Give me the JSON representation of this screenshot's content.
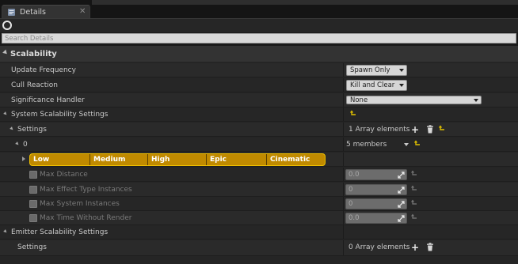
{
  "tab": {
    "title": "Details",
    "close": "✕",
    "icon": "details-icon"
  },
  "toolbar": {
    "icon": "lock-icon"
  },
  "search": {
    "placeholder": "Search Details",
    "value": ""
  },
  "category": {
    "label": "Scalability"
  },
  "properties": {
    "update_frequency": {
      "label": "Update Frequency",
      "value": "Spawn Only"
    },
    "cull_reaction": {
      "label": "Cull Reaction",
      "value": "Kill and Clear"
    },
    "significance_handler": {
      "label": "Significance Handler",
      "value": "None"
    }
  },
  "system_scalability": {
    "label": "System Scalability Settings",
    "settings_label": "Settings",
    "settings_count": "1 Array elements",
    "element_index": "0",
    "element_members": "5 members",
    "levels": [
      "Low",
      "Medium",
      "High",
      "Epic",
      "Cinematic"
    ],
    "fields": [
      {
        "label": "Max Distance",
        "value": "0.0"
      },
      {
        "label": "Max Effect Type Instances",
        "value": "0"
      },
      {
        "label": "Max System Instances",
        "value": "0"
      },
      {
        "label": "Max Time Without Render",
        "value": "0.0"
      }
    ]
  },
  "emitter_scalability": {
    "label": "Emitter Scalability Settings",
    "settings_label": "Settings",
    "settings_count": "0 Array elements"
  },
  "colors": {
    "accent": "#c08a00",
    "accent_border": "#f0c000",
    "reset_arrow": "#e0c000",
    "panel": "#252525"
  }
}
